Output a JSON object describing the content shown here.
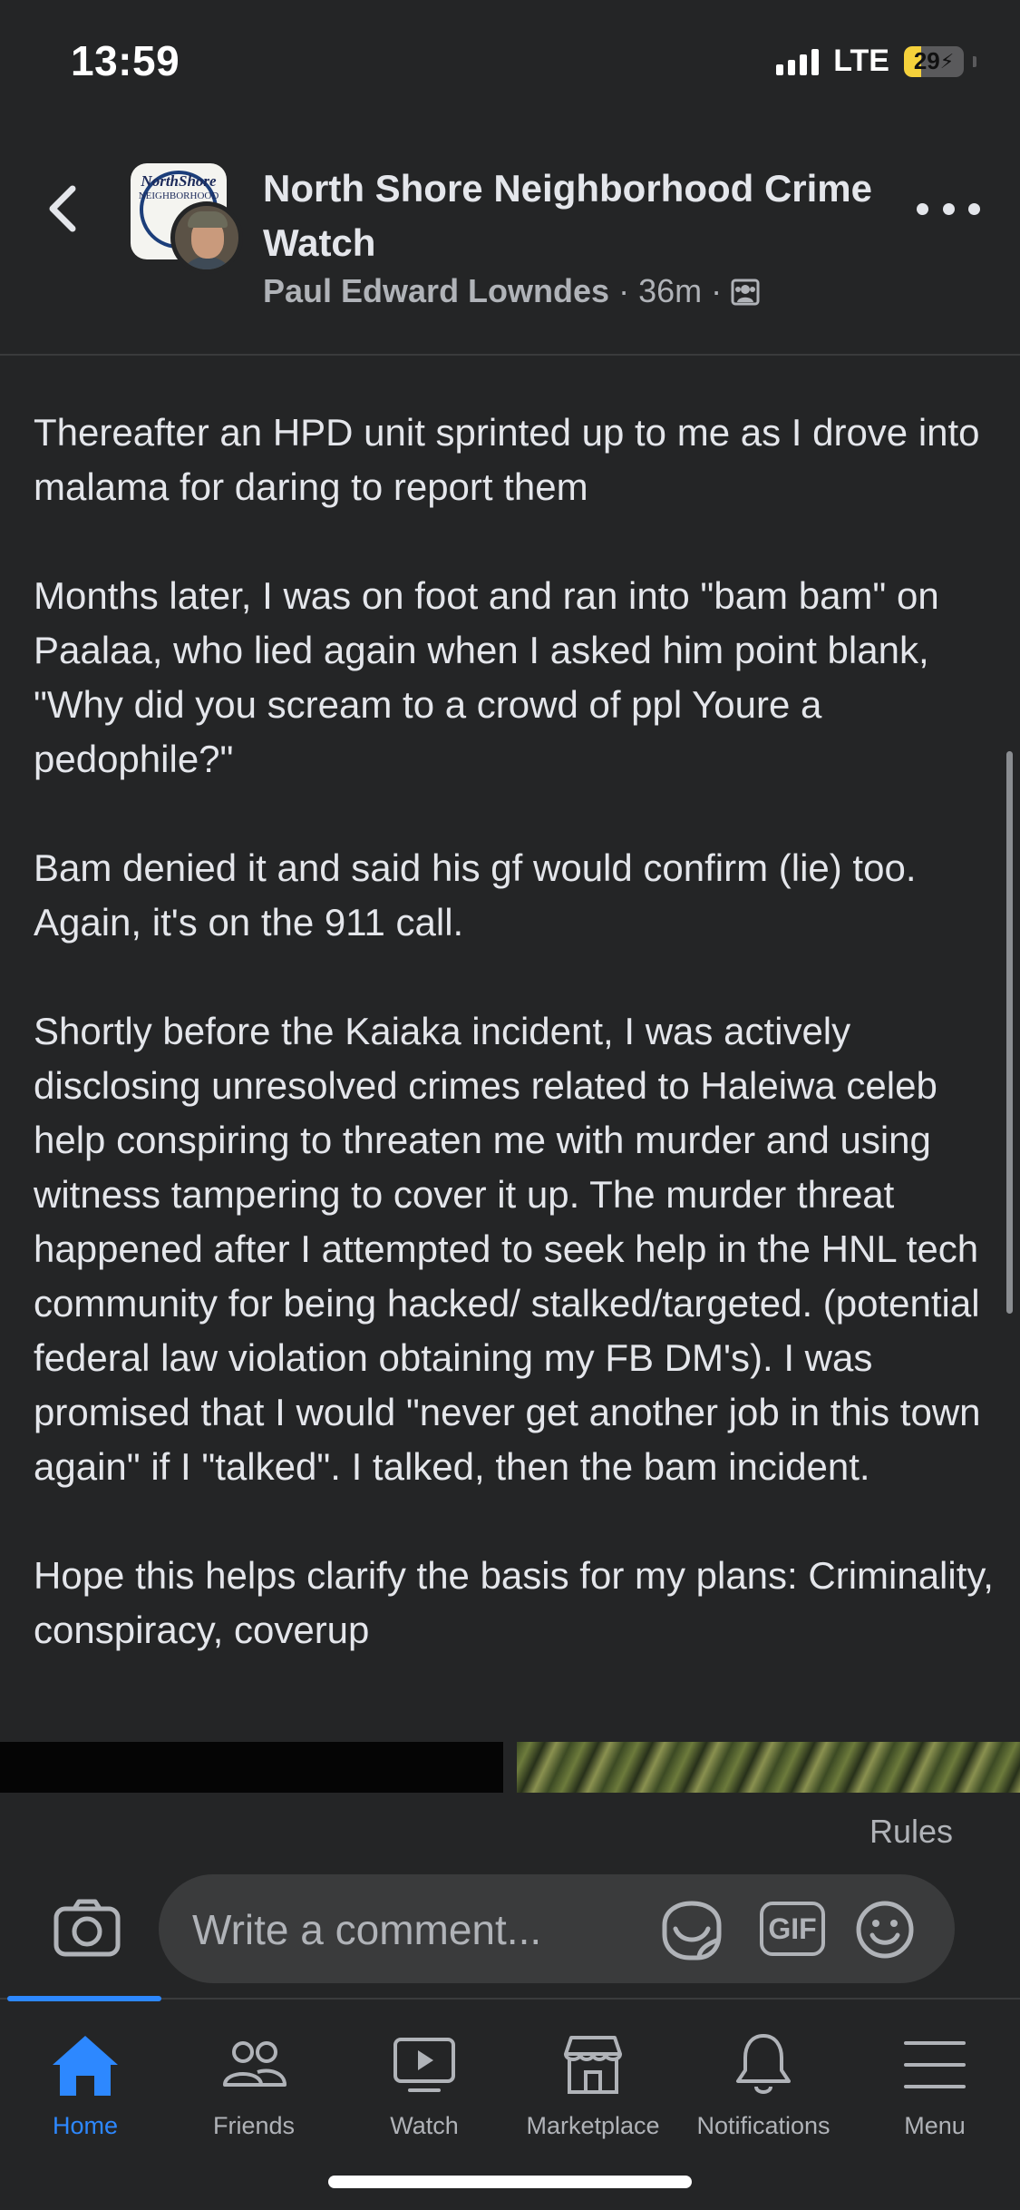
{
  "status_bar": {
    "time": "13:59",
    "network": "LTE",
    "battery_level": "29",
    "battery_fraction": 0.29,
    "battery_color": "#f5d13b"
  },
  "header": {
    "group_name": "North Shore Neighborhood Crime Watch",
    "author": "Paul Edward Lowndes",
    "time_ago": "36m",
    "audience_icon": "members-icon",
    "group_logo_text": "NorthShore",
    "group_logo_subtext": "NEIGHBORHOOD",
    "back_icon": "chevron-left-icon",
    "more_icon": "more-horizontal-icon"
  },
  "post": {
    "paragraphs": [
      "Thereafter an HPD unit sprinted up to me as I drove into malama for daring to report them",
      "Months later, I was on foot and ran into \"bam bam\" on Paalaa, who lied again when I asked him point blank, \"Why did you scream to a crowd of ppl Youre a pedophile?\"",
      "Bam denied it and said his gf would confirm (lie) too. Again, it's on the 911 call.",
      "Shortly before the Kaiaka incident, I was actively disclosing unresolved crimes related to Haleiwa celeb help conspiring to threaten me with murder and using witness tampering to cover it up. The murder threat happened after I attempted to seek help in the HNL tech community for being hacked/ stalked/targeted. (potential federal law violation obtaining my FB DM's). I was promised that I would \"never get another job in this town again\" if I \"talked\". I talked, then the bam incident.",
      "Hope this helps clarify the basis for my plans: Criminality, conspiracy, coverup"
    ]
  },
  "comment_bar": {
    "rules_label": "Rules",
    "placeholder": "Write a comment...",
    "gif_label": "GIF",
    "camera_icon": "camera-icon",
    "sticker_icon": "sticker-icon",
    "emoji_icon": "emoji-icon"
  },
  "bottom_nav": {
    "active_color": "#2d88ff",
    "items": [
      {
        "label": "Home",
        "icon": "home-icon"
      },
      {
        "label": "Friends",
        "icon": "friends-icon"
      },
      {
        "label": "Watch",
        "icon": "watch-icon"
      },
      {
        "label": "Marketplace",
        "icon": "marketplace-icon"
      },
      {
        "label": "Notifications",
        "icon": "bell-icon"
      },
      {
        "label": "Menu",
        "icon": "menu-icon"
      }
    ]
  }
}
